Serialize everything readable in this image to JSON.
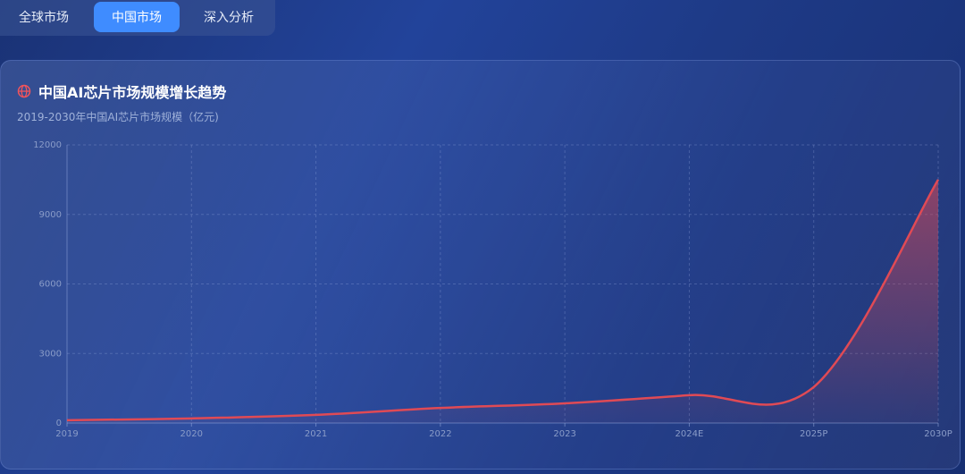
{
  "tabs": [
    {
      "label": "全球市场",
      "active": false
    },
    {
      "label": "中国市场",
      "active": true
    },
    {
      "label": "深入分析",
      "active": false
    }
  ],
  "card": {
    "title": "中国AI芯片市场规模增长趋势",
    "subtitle": "2019-2030年中国AI芯片市场规模（亿元)",
    "icon": "globe-icon"
  },
  "colors": {
    "line": "#e04a55",
    "accent": "#3f8cff"
  },
  "chart_data": {
    "type": "area",
    "title": "中国AI芯片市场规模增长趋势",
    "subtitle": "2019-2030年中国AI芯片市场规模（亿元)",
    "categories": [
      "2019",
      "2020",
      "2021",
      "2022",
      "2023",
      "2024E",
      "2025P",
      "2030P"
    ],
    "values": [
      120,
      200,
      350,
      650,
      850,
      1200,
      1550,
      10500
    ],
    "ylim": [
      0,
      12000
    ],
    "yticks": [
      "0",
      "3000",
      "6000",
      "9000",
      "12000"
    ],
    "grid": true
  }
}
